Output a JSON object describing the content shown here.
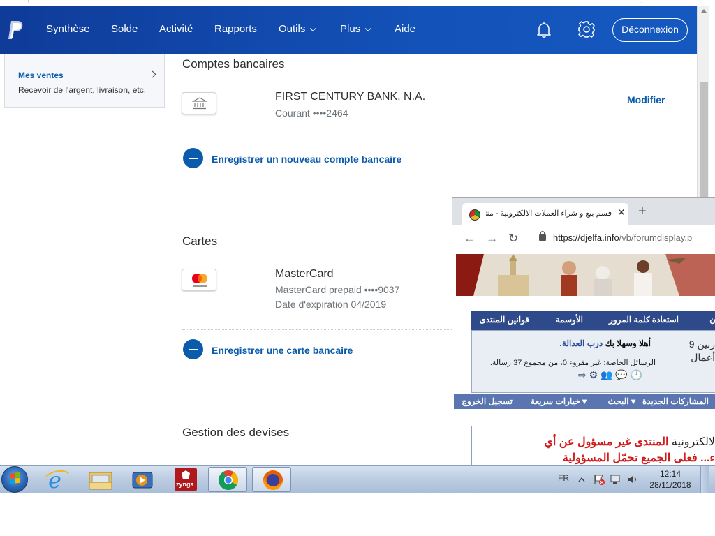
{
  "paypal": {
    "nav": [
      "Synthèse",
      "Solde",
      "Activité",
      "Rapports",
      "Outils",
      "Plus",
      "Aide"
    ],
    "logout": "Déconnexion",
    "brand_color": "#0f3b99"
  },
  "sidebar": {
    "title": "Mes ventes",
    "subtitle": "Recevoir de l'argent, livraison, etc."
  },
  "bank": {
    "section_title": "Comptes bancaires",
    "account_name": "FIRST CENTURY BANK, N.A.",
    "account_type": "Courant ••••2464",
    "edit": "Modifier",
    "add_link": "Enregistrer un nouveau compte bancaire"
  },
  "cards": {
    "section_title": "Cartes",
    "card_name": "MasterCard",
    "card_desc": "MasterCard prepaid ••••9037",
    "card_expiry": "Date d'expiration 04/2019",
    "add_link": "Enregistrer une carte bancaire"
  },
  "currency": {
    "section_title": "Gestion des devises"
  },
  "forum_window": {
    "tab_title": "قسم بيع و شراء العملات الالكترونية - منتدي",
    "url_host": "https://djelfa.info",
    "url_path": "/vb/forumdisplay.p",
    "nav_items": [
      "قوانين المنتدى",
      "الأوسمة",
      "استعادة كلمة المرور",
      "ن"
    ],
    "welcome_title": "أهلا وسهلا بك",
    "welcome_user": "درب العدالة",
    "messages_text": "الرسائل الخاصة: غير مقروء 0، من مجموع 37 رسالة.",
    "side_text_1": "ربين 9",
    "side_text_2": "أعمال",
    "bar2_items": [
      "تسجيل الخروج",
      "خيارات سريعة",
      "البحث",
      "المشاركات الجديدة"
    ],
    "notice_line1_a": "لالكترونية",
    "notice_line1_b": "المنتدى غير مسؤول عن أي",
    "notice_line2": "ء... فعلى الجميع تحمّل المسؤولية"
  },
  "taskbar": {
    "lang": "FR",
    "time": "12:14",
    "date": "28/11/2018"
  }
}
